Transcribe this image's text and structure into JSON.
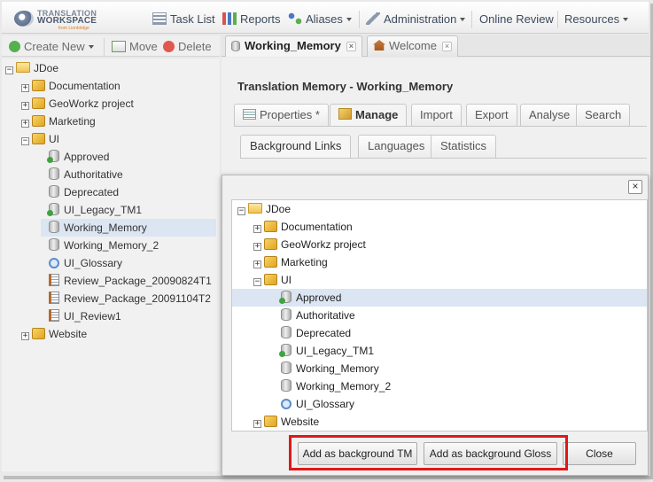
{
  "logo": {
    "line1": "TRANSLATION",
    "line2": "WORKSPACE",
    "line3": "from Lionbridge"
  },
  "topnav": {
    "task_list": "Task List",
    "reports": "Reports",
    "aliases": "Aliases",
    "administration": "Administration",
    "online_review": "Online Review",
    "resources": "Resources"
  },
  "left_toolbar": {
    "create_new": "Create New",
    "move": "Move",
    "delete": "Delete"
  },
  "left_tree": {
    "root": "JDoe",
    "items": [
      "Documentation",
      "GeoWorkz project",
      "Marketing",
      "UI",
      "Approved",
      "Authoritative",
      "Deprecated",
      "UI_Legacy_TM1",
      "Working_Memory",
      "Working_Memory_2",
      "UI_Glossary",
      "Review_Package_20090824T1",
      "Review_Package_20091104T2",
      "UI_Review1",
      "Website"
    ]
  },
  "doc_tabs": [
    "Working_Memory",
    "Welcome"
  ],
  "main": {
    "heading": "Translation Memory - Working_Memory",
    "tabs": [
      "Properties *",
      "Manage",
      "Import",
      "Export",
      "Analyse",
      "Search"
    ],
    "subtabs": [
      "Background Links",
      "Languages",
      "Statistics"
    ]
  },
  "dialog": {
    "tree": {
      "root": "JDoe",
      "items": [
        "Documentation",
        "GeoWorkz project",
        "Marketing",
        "UI",
        "Approved",
        "Authoritative",
        "Deprecated",
        "UI_Legacy_TM1",
        "Working_Memory",
        "Working_Memory_2",
        "UI_Glossary",
        "Website"
      ]
    },
    "buttons": {
      "add_tm": "Add as background TM",
      "add_gloss": "Add as background Gloss",
      "close": "Close"
    }
  },
  "colors": {
    "selection": "#dce6f2",
    "highlight_border": "#e01818"
  }
}
